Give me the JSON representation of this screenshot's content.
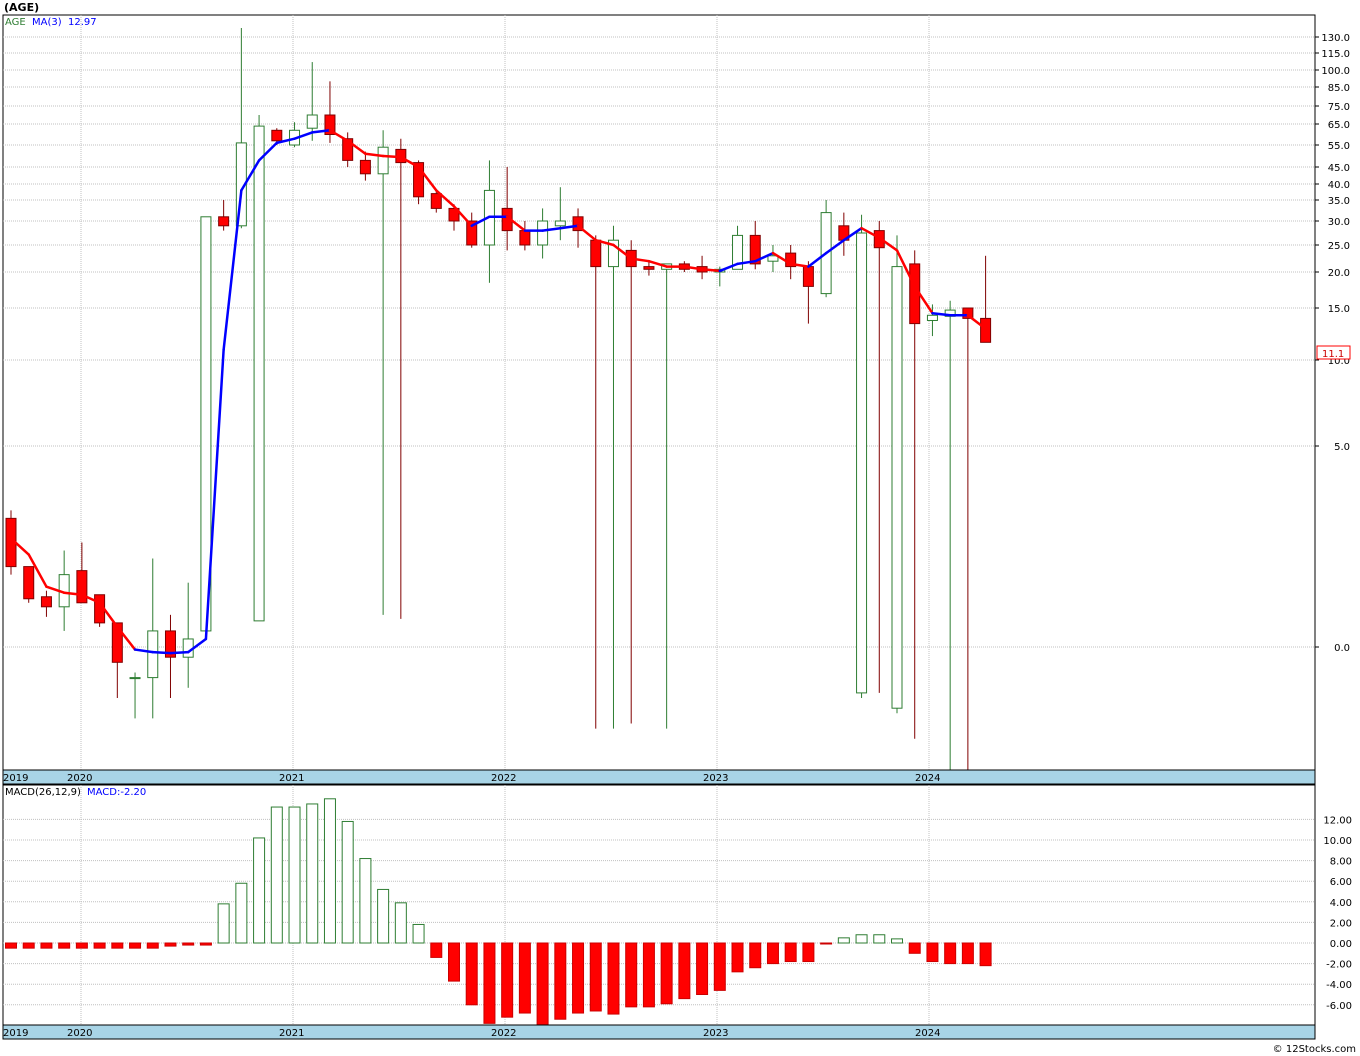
{
  "header": {
    "symbol": "(AGE)"
  },
  "price_panel": {
    "legend_symbol": "AGE",
    "legend_ma": "MA(3)",
    "legend_ma_value": "12.97",
    "last_price_label": "11.1"
  },
  "macd_panel": {
    "legend_name": "MACD(26,12,9)",
    "legend_value": "MACD:-2.20"
  },
  "footer": {
    "copyright": "© 12Stocks.com"
  },
  "colors": {
    "up_candle": "#2e7d32",
    "down_candle": "#ff0000",
    "ma_up": "#0000ff",
    "ma_down": "#ff0000",
    "axis_band": "#a8d4e6",
    "grid": "#c0c0c0"
  },
  "chart_data": [
    {
      "type": "candlestick",
      "period": "monthly",
      "y_scale": "custom (labels as printed)",
      "y_ticks": [
        "130.0",
        "115.0",
        "100.0",
        "85.0",
        "75.0",
        "65.0",
        "55.0",
        "45.0",
        "40.0",
        "35.0",
        "30.0",
        "25.0",
        "20.0",
        "15.0",
        "10.0",
        "5.0",
        "0.0"
      ],
      "x_year_labels": [
        "2019",
        "2020",
        "2021",
        "2022",
        "2023",
        "2024"
      ],
      "grid": true,
      "candles": [
        {
          "o": 3.2,
          "h": 3.4,
          "l": 1.8,
          "c": 2.0
        },
        {
          "o": 2.0,
          "h": 2.0,
          "l": 1.1,
          "c": 1.2
        },
        {
          "o": 1.25,
          "h": 1.4,
          "l": 0.75,
          "c": 1.0
        },
        {
          "o": 1.0,
          "h": 2.4,
          "l": 0.4,
          "c": 1.8
        },
        {
          "o": 1.9,
          "h": 2.6,
          "l": 1.1,
          "c": 1.1
        },
        {
          "o": 1.3,
          "h": 1.3,
          "l": 0.5,
          "c": 0.6
        },
        {
          "o": 0.6,
          "h": 0.6,
          "l": -1.0,
          "c": -0.3
        },
        {
          "o": -0.6,
          "h": -0.5,
          "l": -1.4,
          "c": -0.6
        },
        {
          "o": -0.6,
          "h": 2.2,
          "l": -1.4,
          "c": 0.4
        },
        {
          "o": 0.4,
          "h": 0.8,
          "l": -1.0,
          "c": -0.2
        },
        {
          "o": -0.2,
          "h": 1.6,
          "l": -0.8,
          "c": 0.2
        },
        {
          "o": 0.4,
          "h": 11.3,
          "l": 0.4,
          "c": 31.0
        },
        {
          "o": 31.0,
          "h": 35.0,
          "l": 28.0,
          "c": 29.0
        },
        {
          "o": 29.0,
          "h": 140.0,
          "l": 28.5,
          "c": 56.0
        },
        {
          "o": 0.65,
          "h": 70.0,
          "l": 0.65,
          "c": 64.0
        },
        {
          "o": 62.0,
          "h": 63.0,
          "l": 55.0,
          "c": 57.0
        },
        {
          "o": 55.0,
          "h": 66.0,
          "l": 54.0,
          "c": 62.0
        },
        {
          "o": 63.0,
          "h": 107.0,
          "l": 57.0,
          "c": 70.0
        },
        {
          "o": 70.0,
          "h": 90.0,
          "l": 56.0,
          "c": 60.0
        },
        {
          "o": 58.0,
          "h": 61.0,
          "l": 45.0,
          "c": 48.0
        },
        {
          "o": 48.0,
          "h": 52.0,
          "l": 41.0,
          "c": 43.0
        },
        {
          "o": 43.0,
          "h": 62.0,
          "l": 0.8,
          "c": 54.0
        },
        {
          "o": 53.0,
          "h": 58.0,
          "l": 0.7,
          "c": 47.0
        },
        {
          "o": 47.0,
          "h": 48.0,
          "l": 34.0,
          "c": 36.0
        },
        {
          "o": 37.0,
          "h": 38.0,
          "l": 32.0,
          "c": 33.0
        },
        {
          "o": 33.0,
          "h": 34.0,
          "l": 28.0,
          "c": 30.0
        },
        {
          "o": 30.0,
          "h": 32.0,
          "l": 24.5,
          "c": 25.0
        },
        {
          "o": 25.0,
          "h": 48.0,
          "l": 18.5,
          "c": 38.0
        },
        {
          "o": 33.0,
          "h": 45.0,
          "l": 24.0,
          "c": 28.0
        },
        {
          "o": 28.0,
          "h": 30.0,
          "l": 24.0,
          "c": 25.0
        },
        {
          "o": 25.0,
          "h": 33.0,
          "l": 22.5,
          "c": 30.0
        },
        {
          "o": 29.0,
          "h": 39.0,
          "l": 26.0,
          "c": 30.0
        },
        {
          "o": 31.0,
          "h": 33.0,
          "l": 24.5,
          "c": 28.0
        },
        {
          "o": 26.0,
          "h": 27.0,
          "l": -1.6,
          "c": 21.0
        },
        {
          "o": 21.0,
          "h": 29.0,
          "l": -1.6,
          "c": 26.0
        },
        {
          "o": 24.0,
          "h": 26.0,
          "l": -1.5,
          "c": 21.0
        },
        {
          "o": 21.0,
          "h": 22.0,
          "l": 19.5,
          "c": 20.5
        },
        {
          "o": 20.5,
          "h": 21.5,
          "l": -1.6,
          "c": 21.5
        },
        {
          "o": 21.5,
          "h": 22.0,
          "l": 20.0,
          "c": 20.5
        },
        {
          "o": 21.0,
          "h": 23.0,
          "l": 19.0,
          "c": 20.0
        },
        {
          "o": 20.0,
          "h": 21.0,
          "l": 18.0,
          "c": 20.5
        },
        {
          "o": 20.5,
          "h": 29.0,
          "l": 20.5,
          "c": 27.0
        },
        {
          "o": 27.0,
          "h": 30.0,
          "l": 20.5,
          "c": 21.5
        },
        {
          "o": 22.0,
          "h": 25.0,
          "l": 20.0,
          "c": 23.0
        },
        {
          "o": 23.5,
          "h": 25.0,
          "l": 19.0,
          "c": 21.0
        },
        {
          "o": 21.0,
          "h": 22.0,
          "l": 13.5,
          "c": 18.0
        },
        {
          "o": 17.0,
          "h": 35.0,
          "l": 16.5,
          "c": 32.0
        },
        {
          "o": 29.0,
          "h": 32.0,
          "l": 23.0,
          "c": 26.0
        },
        {
          "o": -0.9,
          "h": 31.5,
          "l": -1.0,
          "c": 27.5
        },
        {
          "o": 28.0,
          "h": 30.0,
          "l": -0.9,
          "c": 24.5
        },
        {
          "o": -1.2,
          "h": 27.0,
          "l": -1.3,
          "c": 21.0
        },
        {
          "o": 21.5,
          "h": 24.0,
          "l": -1.8,
          "c": 13.5
        },
        {
          "o": 13.8,
          "h": 15.5,
          "l": 12.3,
          "c": 14.3
        },
        {
          "o": 14.2,
          "h": 16.0,
          "l": -2.8,
          "c": 14.8
        },
        {
          "o": 15.0,
          "h": 15.0,
          "l": -2.8,
          "c": 14.0
        },
        {
          "o": 14.0,
          "h": 23.0,
          "l": 11.7,
          "c": 11.7
        }
      ],
      "ma3": [
        2.7,
        2.3,
        1.5,
        1.35,
        1.3,
        1.1,
        0.5,
        -0.05,
        -0.1,
        -0.12,
        -0.1,
        0.2,
        11.0,
        38.0,
        48.0,
        56.0,
        58.0,
        61.0,
        62.0,
        57.0,
        51.0,
        50.0,
        49.5,
        45.0,
        38.0,
        33.5,
        29.0,
        31.0,
        31.0,
        28.0,
        28.0,
        28.5,
        29.0,
        26.0,
        25.0,
        22.5,
        22.0,
        21.0,
        21.0,
        20.5,
        20.2,
        21.5,
        22.0,
        23.5,
        21.5,
        21.0,
        23.5,
        26.0,
        28.5,
        26.5,
        24.0,
        18.0,
        14.5,
        14.3,
        14.3,
        13.0
      ],
      "ma3_rising": [
        false,
        false,
        false,
        false,
        false,
        false,
        false,
        false,
        true,
        true,
        true,
        true,
        true,
        true,
        true,
        true,
        true,
        true,
        true,
        false,
        false,
        false,
        false,
        false,
        false,
        false,
        false,
        true,
        true,
        false,
        true,
        true,
        true,
        false,
        false,
        false,
        false,
        false,
        false,
        false,
        false,
        true,
        true,
        true,
        false,
        false,
        true,
        true,
        true,
        false,
        false,
        false,
        false,
        true,
        true,
        false
      ]
    },
    {
      "type": "bar",
      "name": "MACD(26,12,9)",
      "y_ticks": [
        "12.00",
        "10.00",
        "8.00",
        "6.00",
        "4.00",
        "2.00",
        "0.00",
        "-2.00",
        "-4.00",
        "-6.00"
      ],
      "ylim": [
        -7.8,
        14.0
      ],
      "x_year_labels": [
        "2019",
        "2020",
        "2021",
        "2022",
        "2023",
        "2024"
      ],
      "values": [
        -0.5,
        -0.5,
        -0.5,
        -0.5,
        -0.5,
        -0.5,
        -0.5,
        -0.5,
        -0.5,
        -0.3,
        -0.2,
        -0.2,
        3.8,
        5.8,
        10.2,
        13.2,
        13.2,
        13.5,
        14.0,
        11.8,
        8.2,
        5.2,
        3.9,
        1.8,
        -1.4,
        -3.7,
        -6.0,
        -7.8,
        -7.2,
        -6.8,
        -8.2,
        -7.4,
        -6.8,
        -6.6,
        -6.9,
        -6.2,
        -6.2,
        -5.9,
        -5.4,
        -5.0,
        -4.6,
        -2.8,
        -2.4,
        -2.0,
        -1.8,
        -1.8,
        -0.05,
        0.5,
        0.8,
        0.8,
        0.4,
        -1.0,
        -1.8,
        -2.0,
        -2.0,
        -2.2
      ]
    }
  ]
}
